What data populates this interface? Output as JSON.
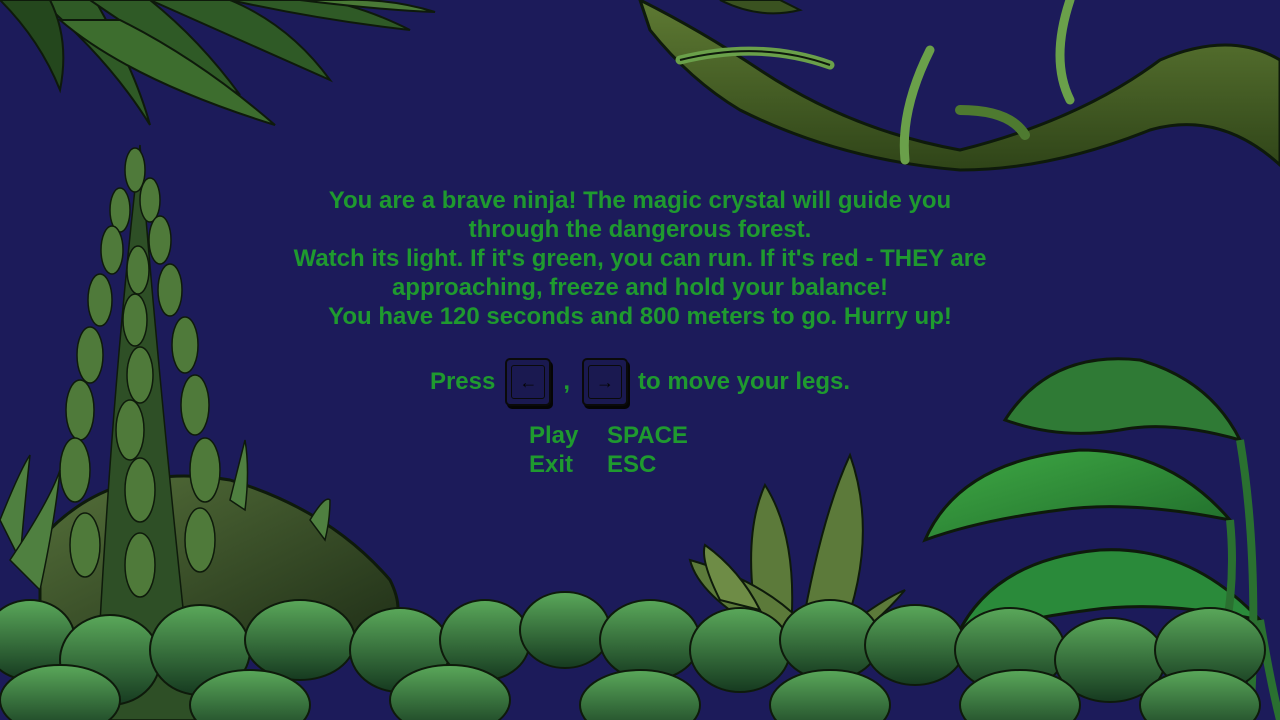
{
  "intro": {
    "line1": "You are a brave ninja! The magic crystal will guide you",
    "line2": "through the dangerous forest.",
    "line3": "Watch its light. If it's green, you can run. If it's red - THEY are",
    "line4": "approaching, freeze and hold your balance!",
    "line5": "You have 120 seconds and 800 meters to go. Hurry up!"
  },
  "controls": {
    "press_label": "Press",
    "left_key": "←",
    "separator": ",",
    "right_key": "→",
    "suffix": "to move your legs."
  },
  "menu": {
    "play_label": "Play",
    "play_key": "SPACE",
    "exit_label": "Exit",
    "exit_key": "ESC"
  },
  "icons": {
    "left_key_icon": "left-arrow-key-icon",
    "right_key_icon": "right-arrow-key-icon"
  },
  "colors": {
    "background": "#1c1b5a",
    "text": "#1f9a2f"
  }
}
